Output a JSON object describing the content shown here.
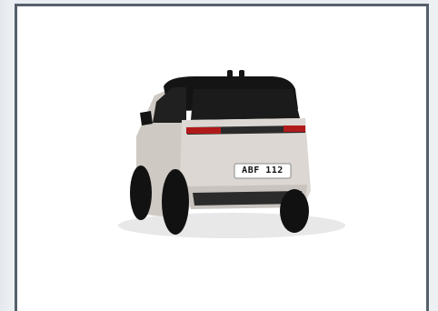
{
  "viewer": {
    "subject": "suv-rear-three-quarter",
    "license_plate": "ABF 112"
  },
  "colors": {
    "body": "#d8d3cf",
    "roof": "#151515",
    "frame_border": "#56606b",
    "taillight": "#b11a1a"
  }
}
